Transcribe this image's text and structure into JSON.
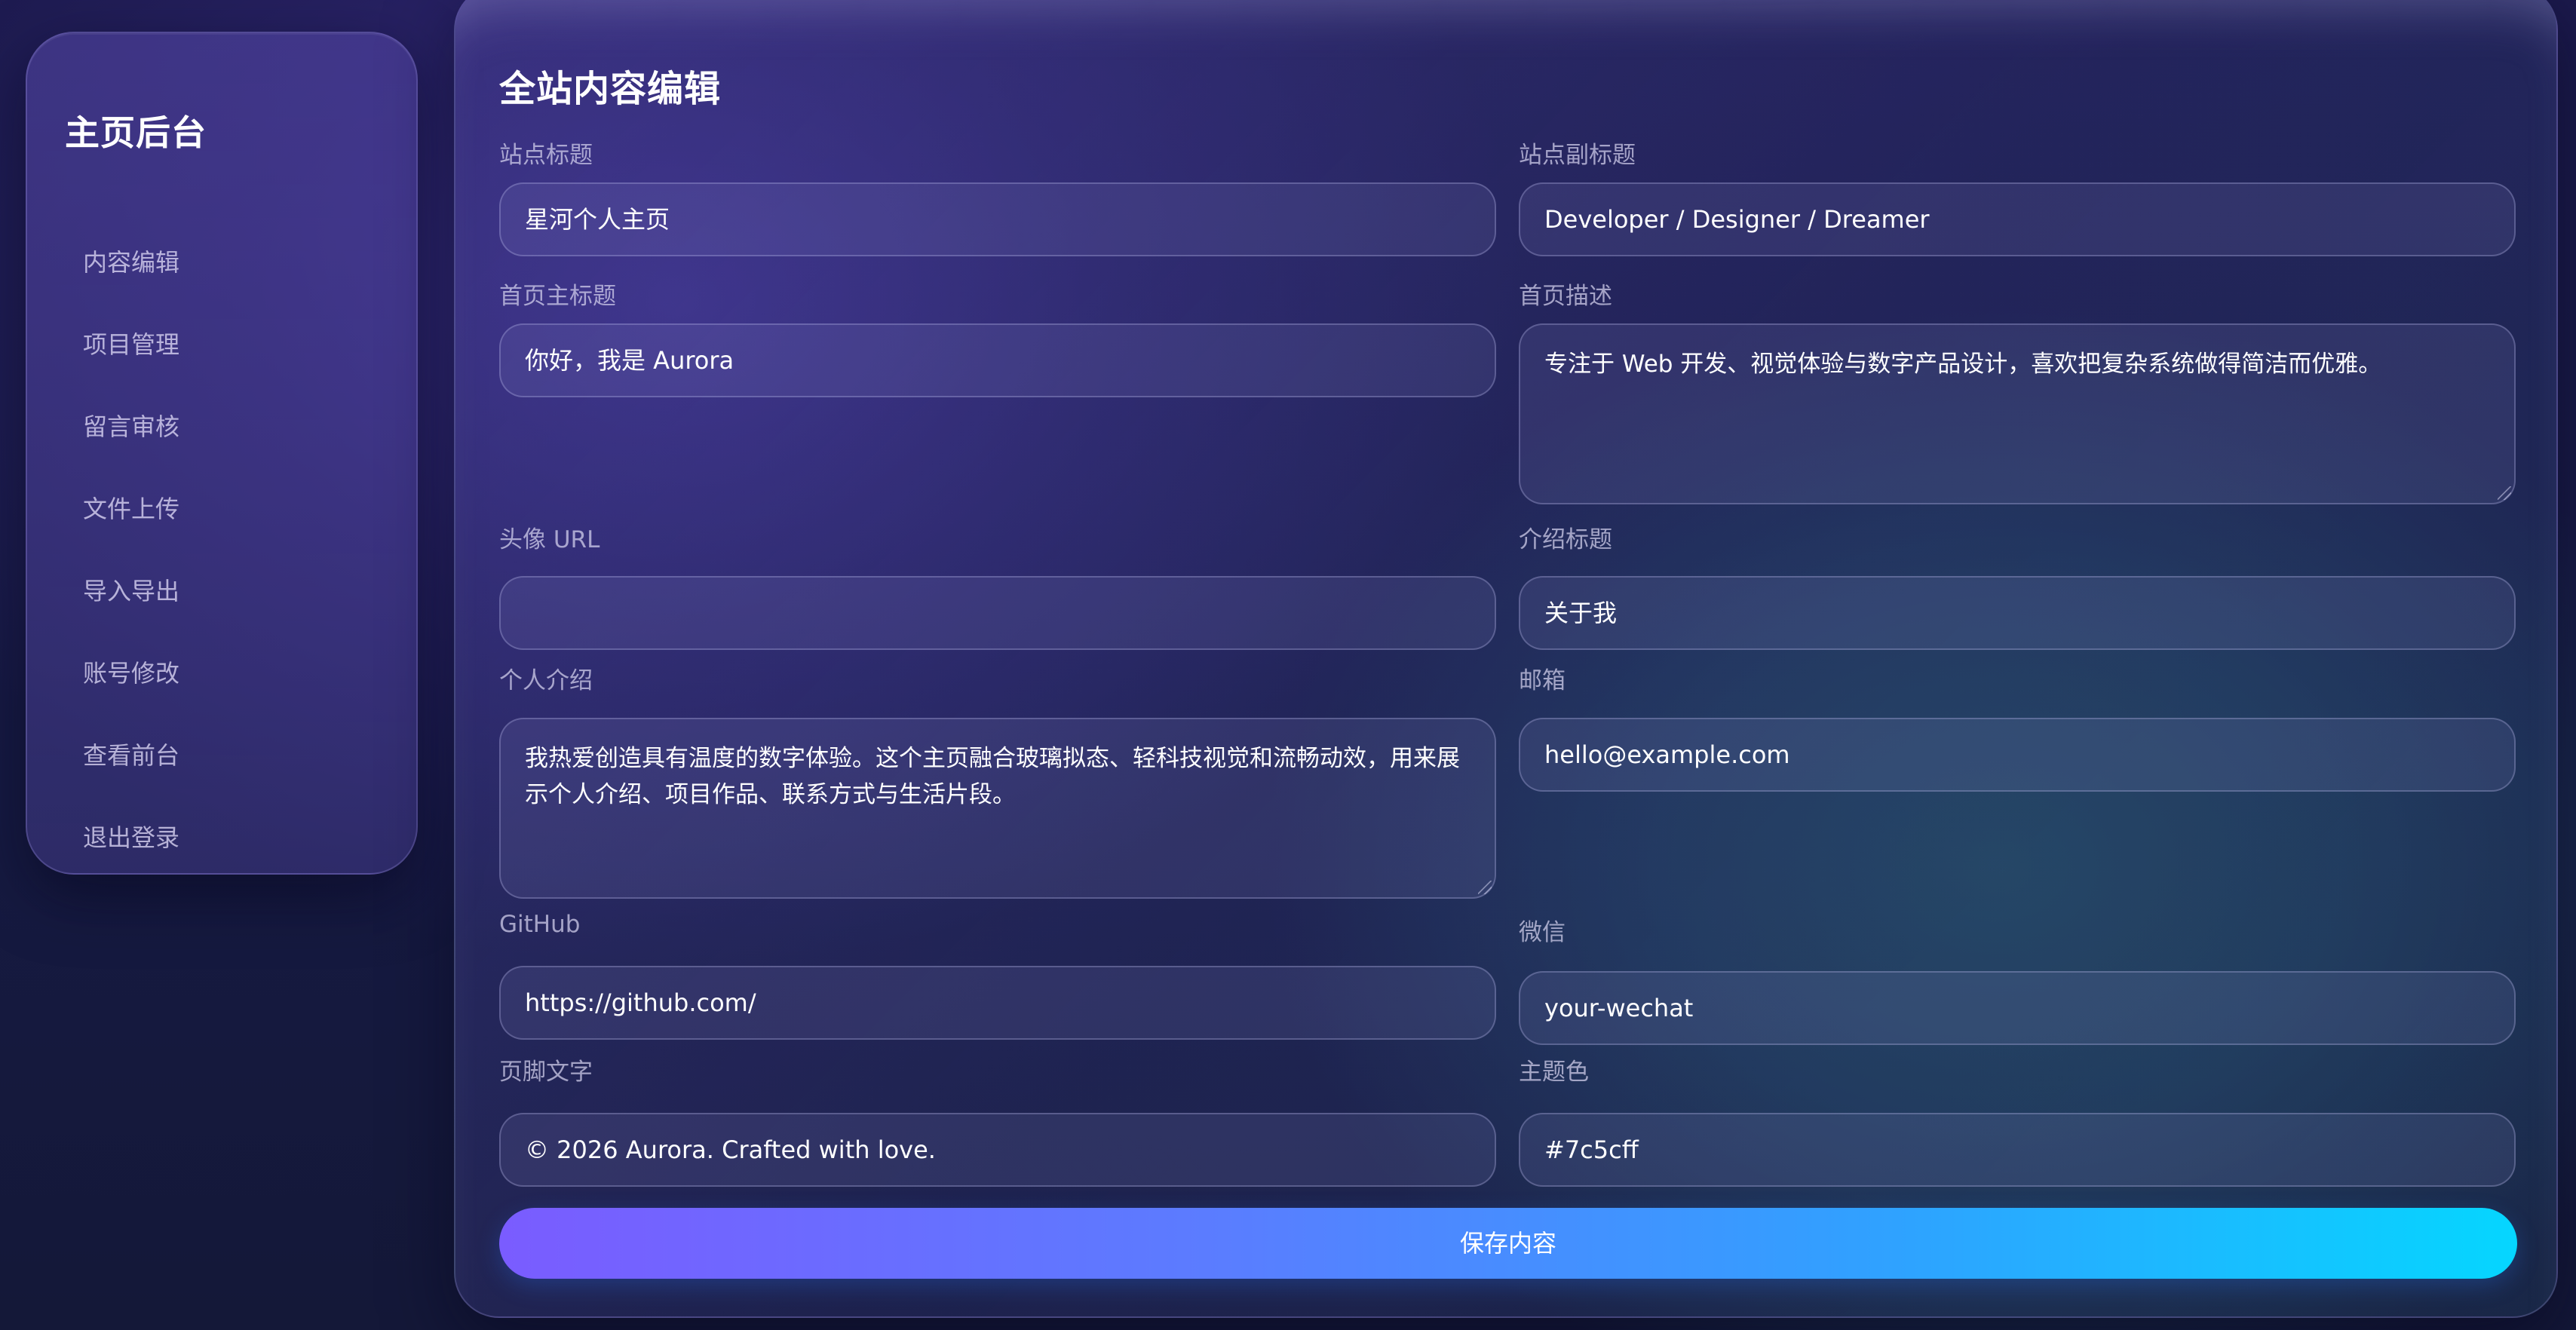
{
  "sidebar": {
    "title": "主页后台",
    "items": [
      {
        "label": "内容编辑"
      },
      {
        "label": "项目管理"
      },
      {
        "label": "留言审核"
      },
      {
        "label": "文件上传"
      },
      {
        "label": "导入导出"
      },
      {
        "label": "账号修改"
      },
      {
        "label": "查看前台"
      },
      {
        "label": "退出登录"
      }
    ]
  },
  "main": {
    "title": "全站内容编辑",
    "fields": {
      "site_title": {
        "label": "站点标题",
        "value": "星河个人主页"
      },
      "site_subtitle": {
        "label": "站点副标题",
        "value": "Developer / Designer / Dreamer"
      },
      "hero_title": {
        "label": "首页主标题",
        "value": "你好，我是 Aurora"
      },
      "hero_desc": {
        "label": "首页描述",
        "value": "专注于 Web 开发、视觉体验与数字产品设计，喜欢把复杂系统做得简洁而优雅。"
      },
      "avatar_url": {
        "label": "头像 URL",
        "value": ""
      },
      "intro_title": {
        "label": "介绍标题",
        "value": "关于我"
      },
      "intro": {
        "label": "个人介绍",
        "value": "我热爱创造具有温度的数字体验。这个主页融合玻璃拟态、轻科技视觉和流畅动效，用来展示个人介绍、项目作品、联系方式与生活片段。"
      },
      "email": {
        "label": "邮箱",
        "value": "hello@example.com"
      },
      "github": {
        "label": "GitHub",
        "value": "https://github.com/"
      },
      "wechat": {
        "label": "微信",
        "value": "your-wechat"
      },
      "footer": {
        "label": "页脚文字",
        "value": "© 2026 Aurora. Crafted with love."
      },
      "theme_color": {
        "label": "主题色",
        "value": "#7c5cff"
      }
    },
    "save_label": "保存内容"
  },
  "colors": {
    "accent_start": "#7a5cff",
    "accent_end": "#05d6ff"
  }
}
